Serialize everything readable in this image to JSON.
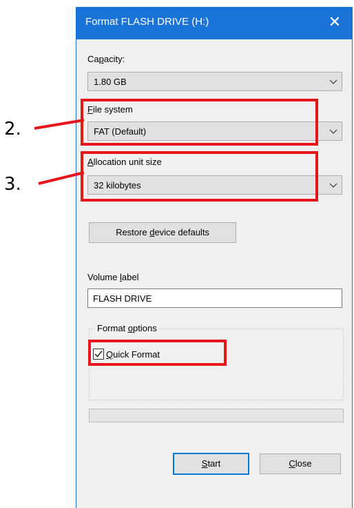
{
  "window": {
    "title": "Format FLASH DRIVE (H:)",
    "close_glyph": "✕"
  },
  "capacity": {
    "label_pre": "Ca",
    "label_mnemonic": "p",
    "label_post": "acity:",
    "value": "1.80 GB"
  },
  "file_system": {
    "label_pre": "",
    "label_mnemonic": "F",
    "label_post": "ile system",
    "value": "FAT (Default)"
  },
  "allocation": {
    "label_pre": "",
    "label_mnemonic": "A",
    "label_post": "llocation unit size",
    "value": "32 kilobytes"
  },
  "restore_button": {
    "label_pre": "Restore ",
    "label_mnemonic": "d",
    "label_post": "evice defaults"
  },
  "volume_label": {
    "label_pre": "Volume ",
    "label_mnemonic": "l",
    "label_post": "abel",
    "value": "FLASH DRIVE"
  },
  "format_options": {
    "legend_pre": "Format ",
    "legend_mnemonic": "o",
    "legend_post": "ptions",
    "quick_format": {
      "label_pre": "",
      "label_mnemonic": "Q",
      "label_post": "uick Format",
      "checked": true
    }
  },
  "progress": {
    "value_percent": 0
  },
  "buttons": {
    "start_pre": "",
    "start_mnemonic": "S",
    "start_post": "tart",
    "close_pre": "",
    "close_mnemonic": "C",
    "close_post": "lose"
  },
  "annotations": {
    "step2": "2.",
    "step3": "3.",
    "highlight_color": "#e8141b"
  },
  "colors": {
    "titlebar": "#1a73d6",
    "dialog_bg": "#f0f0f0",
    "accent": "#0078d7"
  },
  "icons": {
    "dropdown": "chevron-down-icon",
    "close": "close-icon",
    "check": "checkmark-icon"
  }
}
